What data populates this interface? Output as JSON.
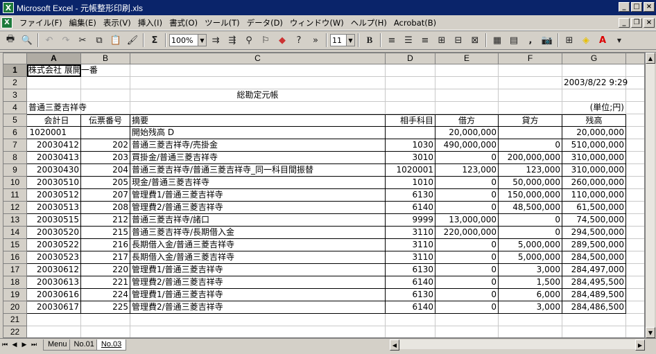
{
  "window": {
    "title": "Microsoft Excel - 元帳整形印刷.xls",
    "icon": "excel-icon"
  },
  "menu": [
    "ファイル(F)",
    "編集(E)",
    "表示(V)",
    "挿入(I)",
    "書式(O)",
    "ツール(T)",
    "データ(D)",
    "ウィンドウ(W)",
    "ヘルプ(H)",
    "Acrobat(B)"
  ],
  "toolbar": {
    "zoom": "100%",
    "font_size": "11",
    "bold": "B",
    "comma": ",",
    "sigma": "Σ"
  },
  "columns": [
    "A",
    "B",
    "C",
    "D",
    "E",
    "F",
    "G"
  ],
  "rows": [
    {
      "n": "1",
      "cells": [
        "株式会社 展開一番",
        "",
        "",
        "",
        "",
        "",
        ""
      ]
    },
    {
      "n": "2",
      "cells": [
        "",
        "",
        "",
        "",
        "",
        "",
        "2003/8/22 9:29"
      ]
    },
    {
      "n": "3",
      "cells": [
        "",
        "",
        "総勘定元帳",
        "",
        "",
        "",
        ""
      ]
    },
    {
      "n": "4",
      "cells": [
        "普通三菱吉祥寺",
        "",
        "",
        "",
        "",
        "",
        "(単位;円)"
      ]
    },
    {
      "n": "5",
      "cells": [
        "会計日",
        "伝票番号",
        "摘要",
        "相手科目",
        "借方",
        "貸方",
        "残高"
      ]
    },
    {
      "n": "6",
      "cells": [
        "1020001",
        "",
        "開始残高 D",
        "",
        "20,000,000",
        "",
        "20,000,000"
      ]
    },
    {
      "n": "7",
      "cells": [
        "20030412",
        "202",
        "普通三菱吉祥寺/売掛金",
        "1030",
        "490,000,000",
        "0",
        "510,000,000"
      ]
    },
    {
      "n": "8",
      "cells": [
        "20030413",
        "203",
        "買掛金/普通三菱吉祥寺",
        "3010",
        "0",
        "200,000,000",
        "310,000,000"
      ]
    },
    {
      "n": "9",
      "cells": [
        "20030430",
        "204",
        "普通三菱吉祥寺/普通三菱吉祥寺_同一科目間振替",
        "1020001",
        "123,000",
        "123,000",
        "310,000,000"
      ]
    },
    {
      "n": "10",
      "cells": [
        "20030510",
        "205",
        "現金/普通三菱吉祥寺",
        "1010",
        "0",
        "50,000,000",
        "260,000,000"
      ]
    },
    {
      "n": "11",
      "cells": [
        "20030512",
        "207",
        "管理費1/普通三菱吉祥寺",
        "6130",
        "0",
        "150,000,000",
        "110,000,000"
      ]
    },
    {
      "n": "12",
      "cells": [
        "20030513",
        "208",
        "管理費2/普通三菱吉祥寺",
        "6140",
        "0",
        "48,500,000",
        "61,500,000"
      ]
    },
    {
      "n": "13",
      "cells": [
        "20030515",
        "212",
        "普通三菱吉祥寺/諸口",
        "9999",
        "13,000,000",
        "0",
        "74,500,000"
      ]
    },
    {
      "n": "14",
      "cells": [
        "20030520",
        "215",
        "普通三菱吉祥寺/長期借入金",
        "3110",
        "220,000,000",
        "0",
        "294,500,000"
      ]
    },
    {
      "n": "15",
      "cells": [
        "20030522",
        "216",
        "長期借入金/普通三菱吉祥寺",
        "3110",
        "0",
        "5,000,000",
        "289,500,000"
      ]
    },
    {
      "n": "16",
      "cells": [
        "20030523",
        "217",
        "長期借入金/普通三菱吉祥寺",
        "3110",
        "0",
        "5,000,000",
        "284,500,000"
      ]
    },
    {
      "n": "17",
      "cells": [
        "20030612",
        "220",
        "管理費1/普通三菱吉祥寺",
        "6130",
        "0",
        "3,000",
        "284,497,000"
      ]
    },
    {
      "n": "18",
      "cells": [
        "20030613",
        "221",
        "管理費2/普通三菱吉祥寺",
        "6140",
        "0",
        "1,500",
        "284,495,500"
      ]
    },
    {
      "n": "19",
      "cells": [
        "20030616",
        "224",
        "管理費1/普通三菱吉祥寺",
        "6130",
        "0",
        "6,000",
        "284,489,500"
      ]
    },
    {
      "n": "20",
      "cells": [
        "20030617",
        "225",
        "管理費2/普通三菱吉祥寺",
        "6140",
        "0",
        "3,000",
        "284,486,500"
      ]
    },
    {
      "n": "21",
      "cells": [
        "",
        "",
        "",
        "",
        "",
        "",
        ""
      ]
    },
    {
      "n": "22",
      "cells": [
        "",
        "",
        "",
        "",
        "",
        "",
        ""
      ]
    }
  ],
  "sheet_tabs": [
    "Menu",
    "No.01",
    "No.03"
  ],
  "active_tab": "No.03"
}
